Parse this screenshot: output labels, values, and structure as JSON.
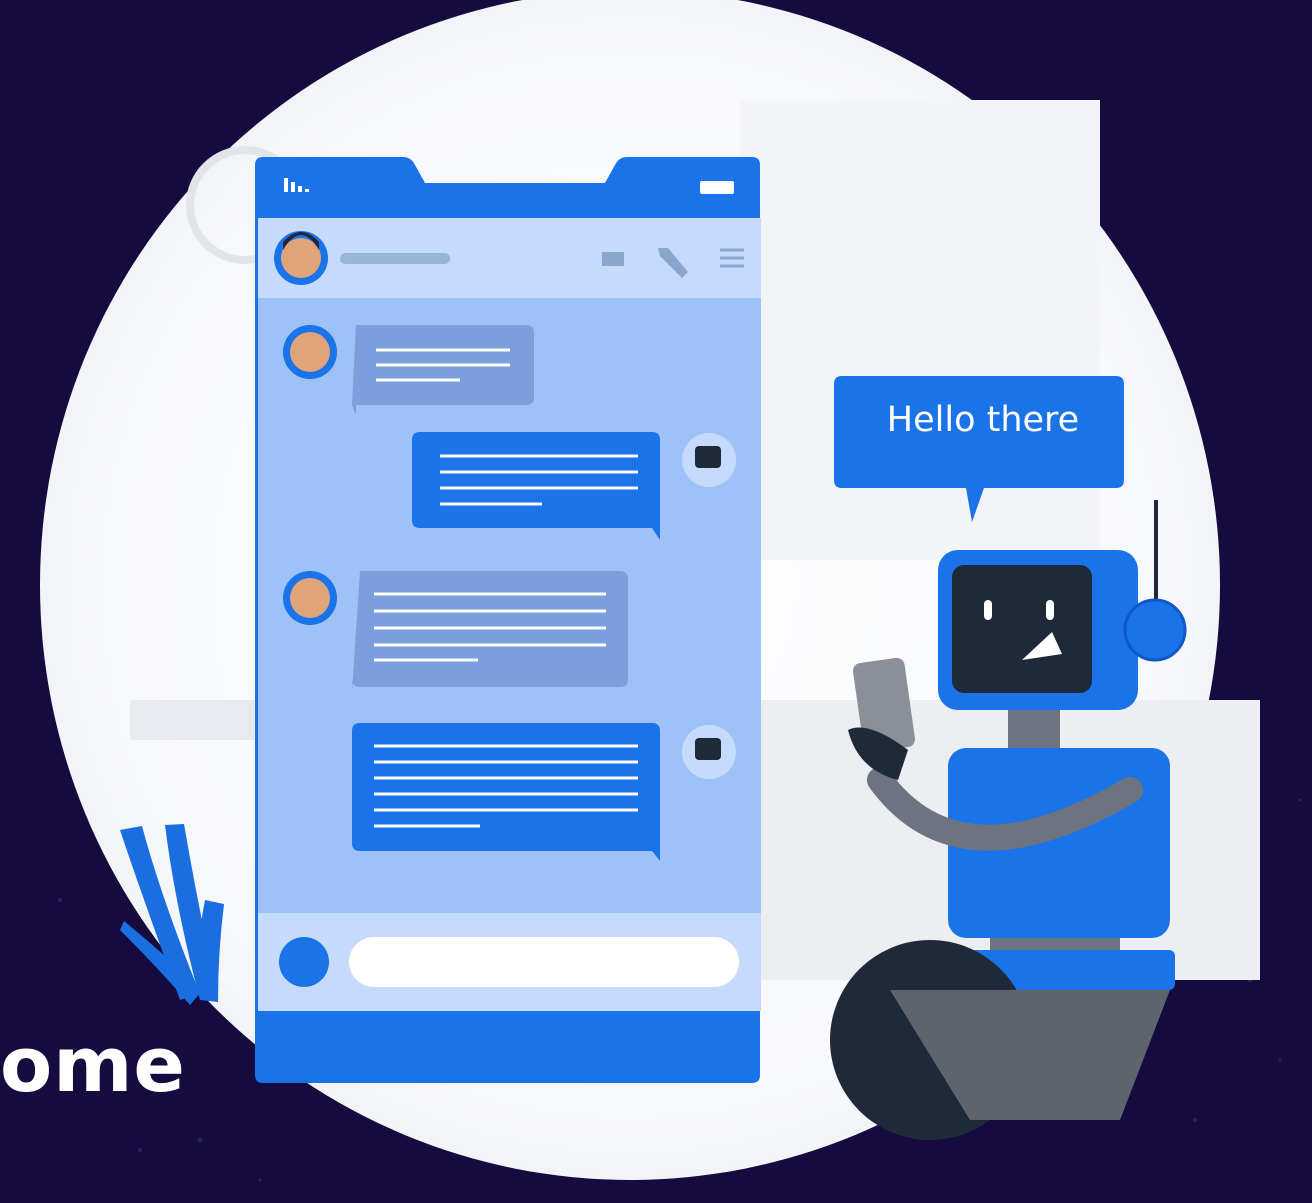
{
  "speech_bubble": {
    "text": "Hello there"
  },
  "caption": {
    "text": "ome"
  },
  "phone": {
    "contact_avatar": "user-avatar-icon",
    "icons": [
      "signal-bars-icon",
      "battery-icon",
      "video-call-icon",
      "phone-call-icon",
      "menu-icon",
      "send-button-icon"
    ]
  },
  "colors": {
    "background": "#150b3f",
    "accent": "#1a73e8",
    "bubble_user": "#7b9fdc",
    "chat_panel": "#9ec1f7"
  }
}
